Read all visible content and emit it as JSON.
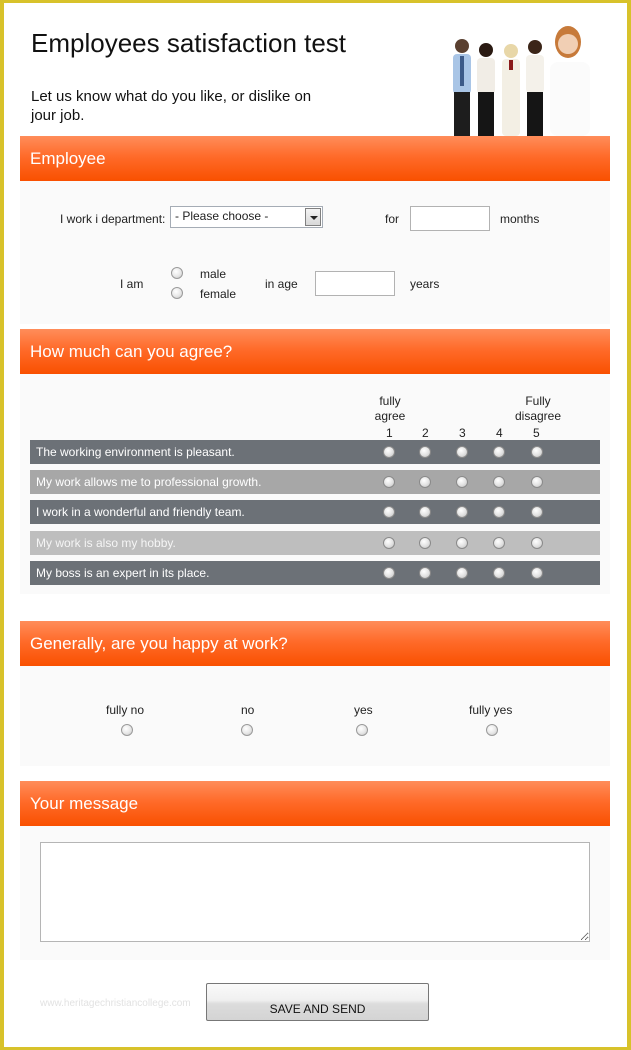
{
  "header": {
    "title": "Employees satisfaction test",
    "subtitle": "Let us know what do you like, or dislike on jour job.",
    "image": "business-team-photo"
  },
  "employee": {
    "heading": "Employee",
    "department_label": "I work i department:",
    "department_select": {
      "selected": "- Please choose -"
    },
    "for_label": "for",
    "months_value": "",
    "months_label": "months",
    "iam_label": "I am",
    "gender_options": [
      "male",
      "female"
    ],
    "age_label": "in age",
    "age_value": "",
    "years_label": "years"
  },
  "agree": {
    "heading": "How much can you agree?",
    "scale_left": [
      "fully",
      "agree"
    ],
    "scale_right": [
      "Fully",
      "disagree"
    ],
    "scale_numbers": [
      "1",
      "2",
      "3",
      "4",
      "5"
    ],
    "statements": [
      "The working environment is pleasant.",
      "My work allows me to professional growth.",
      "I work in a wonderful and friendly team.",
      "My work is also my hobby.",
      "My boss is an expert in its place."
    ]
  },
  "happy": {
    "heading": "Generally, are you happy at work?",
    "options": [
      "fully no",
      "no",
      "yes",
      "fully yes"
    ]
  },
  "message": {
    "heading": "Your message",
    "value": ""
  },
  "footer": {
    "save_label": "SAVE AND SEND",
    "watermark": "www.heritagechristiancollege.com"
  },
  "colors": {
    "frame": "#d8c22a",
    "header_orange": "#f95000",
    "row_dark": "#6c7177",
    "row_light": "#a7a7a7"
  }
}
